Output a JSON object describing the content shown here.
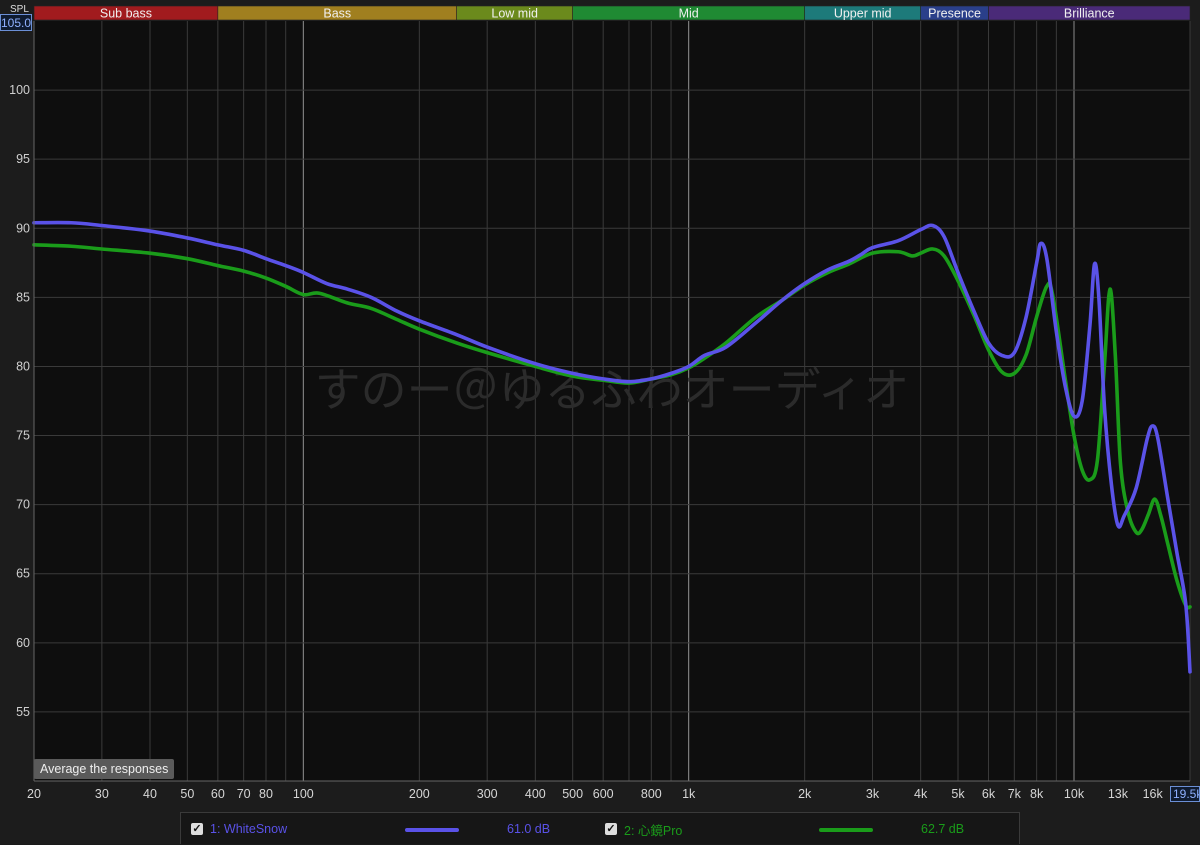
{
  "axis": {
    "y_unit": "SPL",
    "y_top_readout": "105.00",
    "x_right_readout": "19.5k"
  },
  "bands": [
    {
      "label": "Sub bass",
      "from": 20,
      "to": 60,
      "color": "#a11b1e"
    },
    {
      "label": "Bass",
      "from": 60,
      "to": 250,
      "color": "#a07f1f"
    },
    {
      "label": "Low mid",
      "from": 250,
      "to": 500,
      "color": "#6b8a1c"
    },
    {
      "label": "Mid",
      "from": 500,
      "to": 2000,
      "color": "#1f8a33"
    },
    {
      "label": "Upper mid",
      "from": 2000,
      "to": 4000,
      "color": "#1d7a7a"
    },
    {
      "label": "Presence",
      "from": 4000,
      "to": 6000,
      "color": "#2a3f8a"
    },
    {
      "label": "Brilliance",
      "from": 6000,
      "to": 20000,
      "color": "#4a2a78"
    }
  ],
  "controls": {
    "average_label": "Average the responses"
  },
  "legend": [
    {
      "check": "✓",
      "label": "1: WhiteSnow",
      "value": "61.0 dB",
      "color": "#5a52e8"
    },
    {
      "check": "✓",
      "label": "2: 心鏡Pro",
      "value": "62.7 dB",
      "color": "#1a9c1a"
    }
  ],
  "watermark": "すのー＠ゆるふわオーディオ",
  "chart_data": {
    "type": "line",
    "xscale": "log",
    "xlim": [
      20,
      20000
    ],
    "ylim": [
      50,
      105
    ],
    "yticks": [
      55,
      60,
      65,
      70,
      75,
      80,
      85,
      90,
      95,
      100
    ],
    "xticks": [
      {
        "v": 20,
        "label": "20"
      },
      {
        "v": 30,
        "label": "30"
      },
      {
        "v": 40,
        "label": "40"
      },
      {
        "v": 50,
        "label": "50"
      },
      {
        "v": 60,
        "label": "60"
      },
      {
        "v": 70,
        "label": "70"
      },
      {
        "v": 80,
        "label": "80"
      },
      {
        "v": 100,
        "label": "100"
      },
      {
        "v": 200,
        "label": "200"
      },
      {
        "v": 300,
        "label": "300"
      },
      {
        "v": 400,
        "label": "400"
      },
      {
        "v": 500,
        "label": "500"
      },
      {
        "v": 600,
        "label": "600"
      },
      {
        "v": 800,
        "label": "800"
      },
      {
        "v": 1000,
        "label": "1k"
      },
      {
        "v": 2000,
        "label": "2k"
      },
      {
        "v": 3000,
        "label": "3k"
      },
      {
        "v": 4000,
        "label": "4k"
      },
      {
        "v": 5000,
        "label": "5k"
      },
      {
        "v": 6000,
        "label": "6k"
      },
      {
        "v": 7000,
        "label": "7k"
      },
      {
        "v": 8000,
        "label": "8k"
      },
      {
        "v": 10000,
        "label": "10k"
      },
      {
        "v": 13000,
        "label": "13k"
      },
      {
        "v": 16000,
        "label": "16k"
      }
    ],
    "grid": true,
    "series": [
      {
        "name": "1: WhiteSnow",
        "color": "#5a52e8",
        "points": [
          [
            20,
            90.4
          ],
          [
            25,
            90.4
          ],
          [
            30,
            90.2
          ],
          [
            40,
            89.8
          ],
          [
            50,
            89.3
          ],
          [
            60,
            88.8
          ],
          [
            70,
            88.4
          ],
          [
            80,
            87.8
          ],
          [
            90,
            87.3
          ],
          [
            100,
            86.8
          ],
          [
            115,
            86.0
          ],
          [
            130,
            85.6
          ],
          [
            150,
            85.0
          ],
          [
            175,
            84.0
          ],
          [
            200,
            83.3
          ],
          [
            250,
            82.3
          ],
          [
            300,
            81.4
          ],
          [
            400,
            80.2
          ],
          [
            500,
            79.5
          ],
          [
            600,
            79.1
          ],
          [
            700,
            78.9
          ],
          [
            800,
            79.1
          ],
          [
            900,
            79.5
          ],
          [
            1000,
            80.0
          ],
          [
            1100,
            80.8
          ],
          [
            1250,
            81.4
          ],
          [
            1500,
            83.2
          ],
          [
            1750,
            84.8
          ],
          [
            2000,
            86.0
          ],
          [
            2300,
            87.0
          ],
          [
            2600,
            87.6
          ],
          [
            2800,
            88.1
          ],
          [
            3000,
            88.6
          ],
          [
            3500,
            89.1
          ],
          [
            4000,
            89.9
          ],
          [
            4300,
            90.2
          ],
          [
            4600,
            89.4
          ],
          [
            5000,
            86.8
          ],
          [
            5500,
            84.0
          ],
          [
            6000,
            81.7
          ],
          [
            6500,
            80.8
          ],
          [
            7000,
            81.0
          ],
          [
            7500,
            83.5
          ],
          [
            8000,
            87.5
          ],
          [
            8200,
            88.9
          ],
          [
            8500,
            87.8
          ],
          [
            9000,
            82.5
          ],
          [
            9500,
            78.5
          ],
          [
            10000,
            76.4
          ],
          [
            10500,
            77.5
          ],
          [
            11000,
            83.0
          ],
          [
            11300,
            87.4
          ],
          [
            11600,
            85.0
          ],
          [
            12000,
            77.0
          ],
          [
            12500,
            71.5
          ],
          [
            13000,
            68.5
          ],
          [
            13500,
            69.2
          ],
          [
            14500,
            71.2
          ],
          [
            15500,
            74.8
          ],
          [
            16000,
            75.7
          ],
          [
            16500,
            74.8
          ],
          [
            17500,
            70.5
          ],
          [
            18500,
            66.5
          ],
          [
            19500,
            62.8
          ],
          [
            20000,
            57.9
          ]
        ]
      },
      {
        "name": "2: 心鏡Pro",
        "color": "#1a9c1a",
        "points": [
          [
            20,
            88.8
          ],
          [
            25,
            88.7
          ],
          [
            30,
            88.5
          ],
          [
            40,
            88.2
          ],
          [
            50,
            87.8
          ],
          [
            60,
            87.3
          ],
          [
            70,
            86.9
          ],
          [
            80,
            86.4
          ],
          [
            90,
            85.8
          ],
          [
            100,
            85.2
          ],
          [
            110,
            85.3
          ],
          [
            130,
            84.6
          ],
          [
            150,
            84.2
          ],
          [
            175,
            83.4
          ],
          [
            200,
            82.7
          ],
          [
            250,
            81.7
          ],
          [
            300,
            81.0
          ],
          [
            400,
            80.0
          ],
          [
            500,
            79.3
          ],
          [
            600,
            79.0
          ],
          [
            700,
            78.8
          ],
          [
            800,
            79.1
          ],
          [
            900,
            79.4
          ],
          [
            1000,
            79.9
          ],
          [
            1100,
            80.6
          ],
          [
            1250,
            81.7
          ],
          [
            1500,
            83.6
          ],
          [
            1750,
            84.8
          ],
          [
            2000,
            85.9
          ],
          [
            2300,
            86.8
          ],
          [
            2600,
            87.4
          ],
          [
            3000,
            88.2
          ],
          [
            3500,
            88.3
          ],
          [
            3800,
            88.0
          ],
          [
            4000,
            88.2
          ],
          [
            4300,
            88.5
          ],
          [
            4600,
            88.0
          ],
          [
            5000,
            86.2
          ],
          [
            5500,
            83.7
          ],
          [
            6000,
            81.2
          ],
          [
            6500,
            79.6
          ],
          [
            7000,
            79.5
          ],
          [
            7500,
            80.8
          ],
          [
            8000,
            83.6
          ],
          [
            8500,
            85.8
          ],
          [
            8800,
            85.2
          ],
          [
            9500,
            79.0
          ],
          [
            10000,
            75.0
          ],
          [
            10500,
            72.5
          ],
          [
            11000,
            71.8
          ],
          [
            11500,
            73.2
          ],
          [
            12000,
            80.2
          ],
          [
            12400,
            85.6
          ],
          [
            12800,
            80.8
          ],
          [
            13200,
            73.0
          ],
          [
            13800,
            69.5
          ],
          [
            14500,
            68.0
          ],
          [
            15000,
            68.2
          ],
          [
            15600,
            69.3
          ],
          [
            16200,
            70.4
          ],
          [
            16800,
            69.2
          ],
          [
            17500,
            67.2
          ],
          [
            18500,
            64.5
          ],
          [
            19500,
            62.7
          ],
          [
            20000,
            62.6
          ]
        ]
      }
    ]
  }
}
